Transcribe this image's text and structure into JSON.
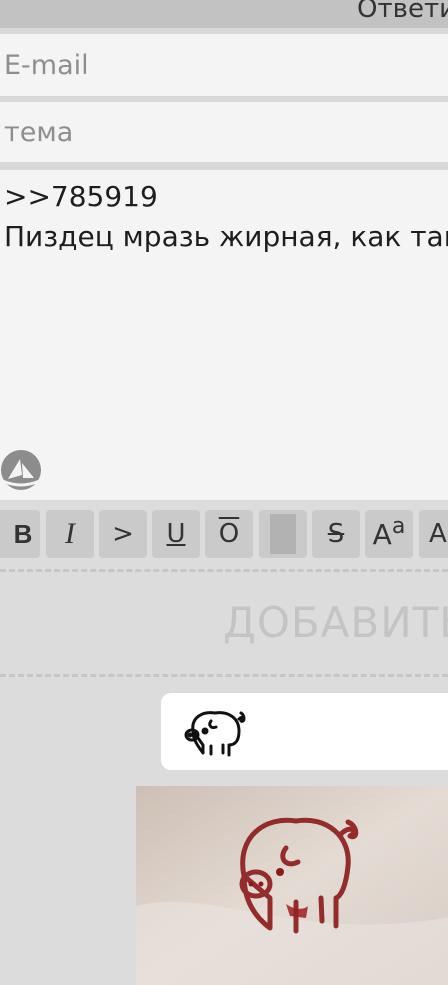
{
  "header": {
    "reply_label": "Ответи"
  },
  "form": {
    "email_placeholder": "E-mail",
    "subject_placeholder": "тема",
    "message_lines": [
      ">>785919",
      "Пиздец мразь жирная, как так"
    ]
  },
  "toolbar": {
    "bold": "B",
    "italic": "I",
    "quote": ">",
    "underline": "U",
    "overline": "O",
    "strike": "S",
    "sup_big": "A",
    "sup_small": "a",
    "next": "A"
  },
  "submit": {
    "label": "ДОБАВИТЬ"
  },
  "icons": {
    "attach": "sail-icon",
    "sticker": "pig-icon"
  },
  "colors": {
    "pig_stroke": "#111111",
    "pig_photo_stroke": "#8b1a1a"
  }
}
